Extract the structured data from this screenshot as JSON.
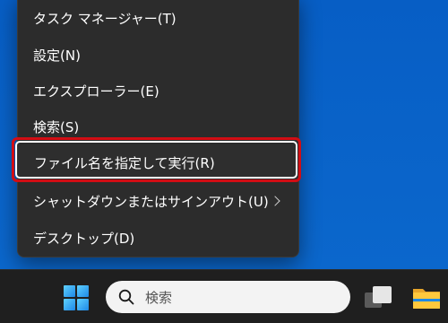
{
  "context_menu": {
    "items": [
      {
        "label": "タスク マネージャー(T)"
      },
      {
        "label": "設定(N)"
      },
      {
        "label": "エクスプローラー(E)"
      },
      {
        "label": "検索(S)"
      },
      {
        "label": "ファイル名を指定して実行(R)"
      },
      {
        "label": "シャットダウンまたはサインアウト(U)"
      },
      {
        "label": "デスクトップ(D)"
      }
    ],
    "highlighted_item": "ファイル名を指定して実行(R)",
    "highlight_color": "#d20d14"
  },
  "taskbar": {
    "search_placeholder": "検索",
    "icons": [
      "windows-start-icon",
      "search-icon",
      "task-view-icon",
      "file-explorer-icon"
    ]
  },
  "colors": {
    "desktop": "#0a64c8",
    "menu_background": "#2c2c2c",
    "taskbar_background": "#1f1f1f"
  }
}
